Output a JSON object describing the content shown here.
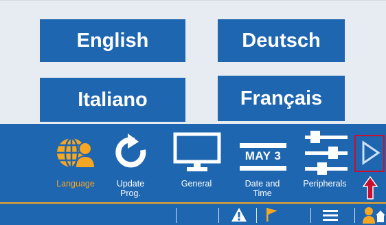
{
  "languages": {
    "english": "English",
    "deutsch": "Deutsch",
    "italiano": "Italiano",
    "francais": "Français"
  },
  "toolbar": {
    "language_label": "Language",
    "update_label": "Update\nProg.",
    "general_label": "General",
    "datetime_label": "Date and\nTime",
    "calendar_text": "MAY 3",
    "peripherals_label": "Peripherals"
  },
  "colors": {
    "brand_blue": "#1e66b0",
    "accent_orange": "#f5a623",
    "highlight_red": "#c8102e",
    "background": "#e6ecf1"
  },
  "icons": {
    "language": "globe-person-icon",
    "update": "refresh-arrow-icon",
    "general": "monitor-icon",
    "datetime": "calendar-icon",
    "peripherals": "sliders-icon",
    "next": "play-next-icon",
    "pointer": "red-up-arrow-icon",
    "status_warning": "warning-icon",
    "status_flag": "flag-icon",
    "status_menu": "menu-icon",
    "status_user": "user-home-icon"
  }
}
